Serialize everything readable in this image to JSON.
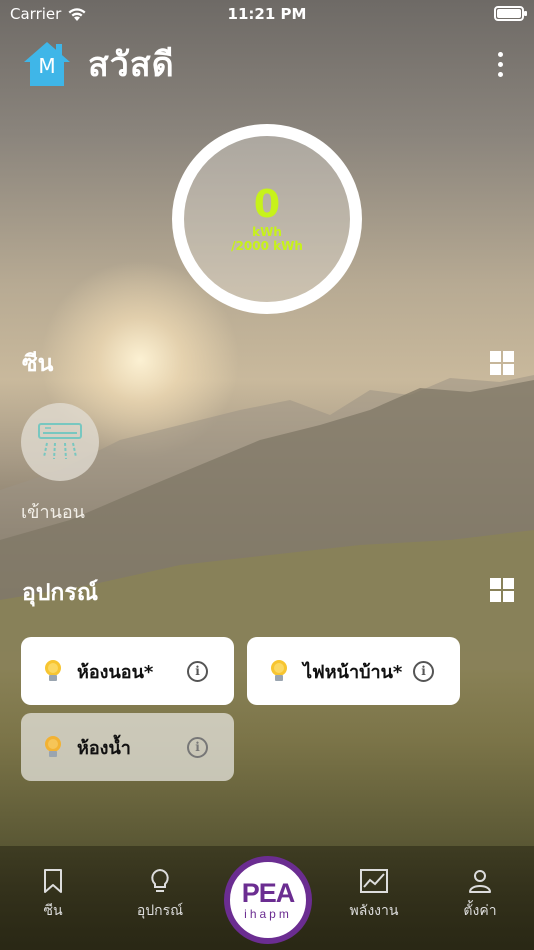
{
  "status_bar": {
    "carrier": "Carrier",
    "time": "11:21 PM"
  },
  "header": {
    "logo_letter": "M",
    "greeting": "สวัสดี"
  },
  "energy": {
    "value": "0",
    "unit": "kWh",
    "limit": "/2000 kWh",
    "accent_color": "#c7f21a"
  },
  "scenes": {
    "title": "ซีน",
    "items": [
      {
        "label": "เข้านอน",
        "icon": "air-conditioner-icon"
      }
    ]
  },
  "devices": {
    "title": "อุปกรณ์",
    "items": [
      {
        "name": "ห้องนอน*",
        "icon": "light-bulb-icon",
        "active": true
      },
      {
        "name": "ไฟหน้าบ้าน*",
        "icon": "light-bulb-icon",
        "active": true
      },
      {
        "name": "ห้องน้ำ",
        "icon": "light-bulb-icon",
        "active": false
      }
    ]
  },
  "tab_bar": {
    "items": [
      {
        "label": "ซีน",
        "icon": "bookmark-icon"
      },
      {
        "label": "อุปกรณ์",
        "icon": "light-bulb-icon"
      },
      {
        "label": "พลังงาน",
        "icon": "chart-icon"
      },
      {
        "label": "ตั้งค่า",
        "icon": "user-icon"
      }
    ],
    "center_logo": {
      "main": "PEA",
      "sub": "ihapm",
      "brand_color": "#6b2d91"
    }
  }
}
